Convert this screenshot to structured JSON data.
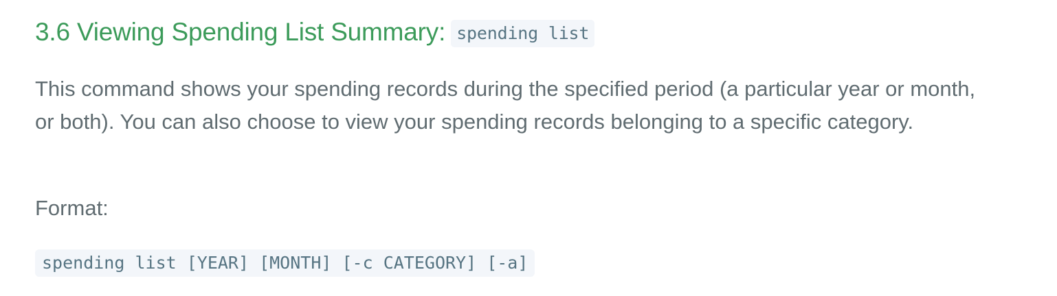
{
  "heading": {
    "title": "3.6 Viewing Spending List Summary:",
    "command": "spending list"
  },
  "description": "This command shows your spending records during the specified period (a particular year or month, or both). You can also choose to view your spending records belonging to a specific category.",
  "format": {
    "label": "Format:",
    "syntax": "spending list [YEAR] [MONTH] [-c CATEGORY] [-a]"
  },
  "colors": {
    "heading": "#3c9b5a",
    "body_text": "#606c71",
    "code_text": "#567482",
    "code_background": "#f3f6fa"
  }
}
